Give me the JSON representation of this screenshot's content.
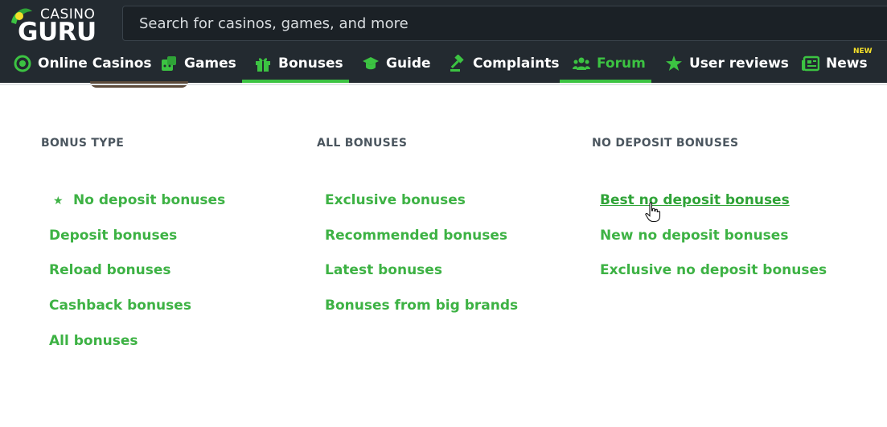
{
  "header": {
    "logo_top": "CASINO",
    "logo_bottom": "GURU",
    "search_placeholder": "Search for casinos, games, and more"
  },
  "nav": {
    "online_casinos": "Online Casinos",
    "games": "Games",
    "bonuses": "Bonuses",
    "guide": "Guide",
    "complaints": "Complaints",
    "forum": "Forum",
    "user_reviews": "User reviews",
    "news": "News",
    "news_badge": "NEW"
  },
  "menu": {
    "bonus_type": {
      "heading": "BONUS TYPE",
      "items": [
        "No deposit bonuses",
        "Deposit bonuses",
        "Reload bonuses",
        "Cashback bonuses",
        "All bonuses"
      ]
    },
    "all_bonuses": {
      "heading": "ALL BONUSES",
      "items": [
        "Exclusive bonuses",
        "Recommended bonuses",
        "Latest bonuses",
        "Bonuses from big brands"
      ]
    },
    "no_deposit": {
      "heading": "NO DEPOSIT BONUSES",
      "items": [
        "Best no deposit bonuses",
        "New no deposit bonuses",
        "Exclusive no deposit bonuses"
      ]
    }
  },
  "colors": {
    "accent_green": "#3cc342",
    "header_bg": "#232a30",
    "badge_yellow": "#f5e02a"
  }
}
